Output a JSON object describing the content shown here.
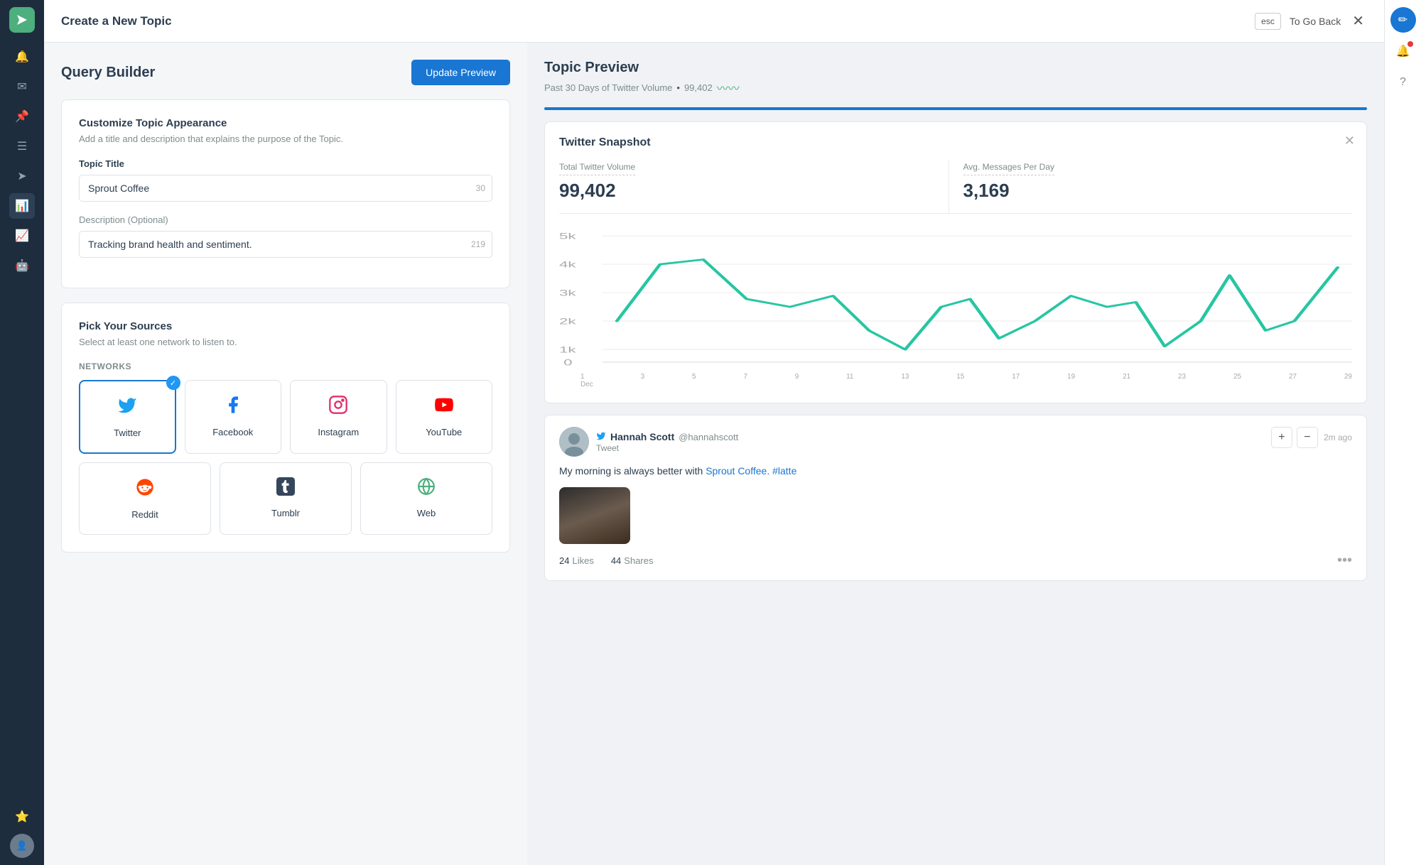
{
  "topbar": {
    "title": "Create a New Topic",
    "esc_label": "esc",
    "go_back_label": "To Go Back"
  },
  "left_panel": {
    "query_builder_title": "Query Builder",
    "update_preview_btn": "Update Preview",
    "customize": {
      "title": "Customize Topic Appearance",
      "subtitle": "Add a title and description that explains the purpose of the Topic.",
      "topic_title_label": "Topic Title",
      "topic_title_value": "Sprout Coffee",
      "topic_title_char_count": "30",
      "description_label": "Description",
      "description_optional": "(Optional)",
      "description_value": "Tracking brand health and sentiment.",
      "description_char_count": "219"
    },
    "sources": {
      "title": "Pick Your Sources",
      "subtitle": "Select at least one network to listen to.",
      "networks_label": "Networks",
      "networks": [
        {
          "id": "twitter",
          "label": "Twitter",
          "selected": true
        },
        {
          "id": "facebook",
          "label": "Facebook",
          "selected": false
        },
        {
          "id": "instagram",
          "label": "Instagram",
          "selected": false
        },
        {
          "id": "youtube",
          "label": "YouTube",
          "selected": false
        }
      ],
      "networks2": [
        {
          "id": "reddit",
          "label": "Reddit",
          "selected": false
        },
        {
          "id": "tumblr",
          "label": "Tumblr",
          "selected": false
        },
        {
          "id": "web",
          "label": "Web",
          "selected": false
        }
      ]
    }
  },
  "right_panel": {
    "title": "Topic Preview",
    "subtitle": "Past 30 Days of Twitter Volume",
    "volume": "99,402",
    "snapshot": {
      "title": "Twitter Snapshot",
      "total_volume_label": "Total Twitter Volume",
      "total_volume_value": "99,402",
      "avg_messages_label": "Avg. Messages Per Day",
      "avg_messages_value": "3,169",
      "chart": {
        "y_labels": [
          "5k",
          "4k",
          "3k",
          "2k",
          "1k",
          "0"
        ],
        "x_labels": [
          "1\nDec",
          "3",
          "5",
          "7",
          "9",
          "11",
          "13",
          "15",
          "17",
          "19",
          "21",
          "23",
          "25",
          "27",
          "29"
        ]
      }
    },
    "tweet": {
      "user_name": "Hannah Scott",
      "user_handle": "@hannahscott",
      "tweet_type": "Tweet",
      "time_ago": "2m ago",
      "body_text": "My morning is always better with ",
      "body_link": "Sprout Coffee.",
      "body_hashtag": "#latte",
      "likes_count": "24",
      "likes_label": "Likes",
      "shares_count": "44",
      "shares_label": "Shares"
    }
  },
  "sidebar": {
    "icons": [
      "📋",
      "✉",
      "📌",
      "≡",
      "✈",
      "📊",
      "📈",
      "🤖",
      "⭐"
    ]
  }
}
